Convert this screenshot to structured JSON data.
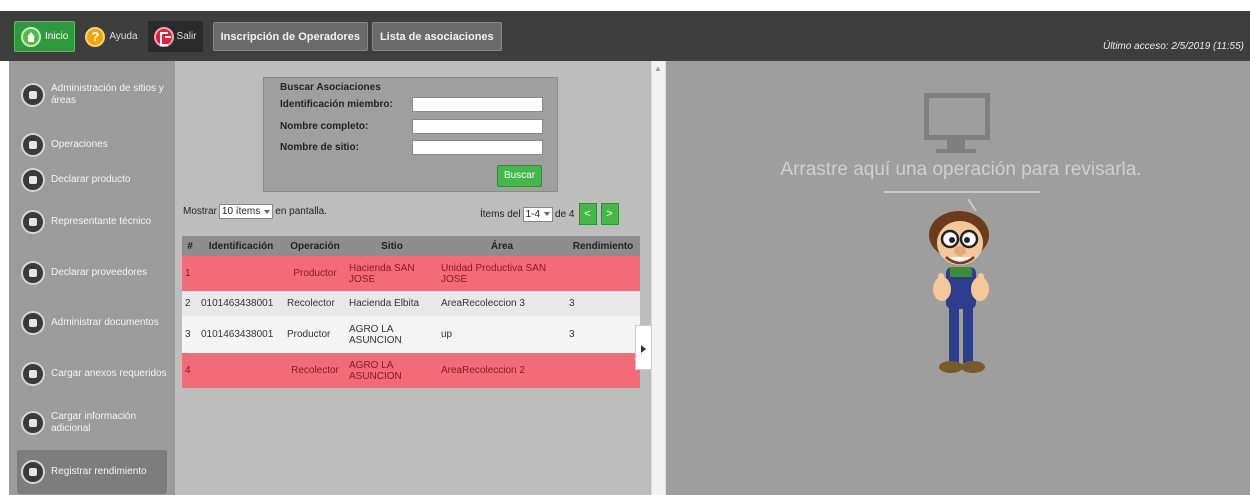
{
  "topbar": {
    "home_label": "Inicio",
    "help_label": "Ayuda",
    "exit_label": "Salir",
    "tab_register": "Inscripción de Operadores",
    "tab_associations": "Lista de asociaciones",
    "last_access": "Último acceso: 2/5/2019 (11:55)"
  },
  "sidebar": {
    "items": [
      {
        "label": "Administración de sitios y áreas",
        "icon": "sites-icon"
      },
      {
        "label": "Operaciones",
        "icon": "operations-icon"
      },
      {
        "label": "Declarar producto",
        "icon": "product-icon"
      },
      {
        "label": "Representante técnico",
        "icon": "technician-icon"
      },
      {
        "label": "Declarar proveedores",
        "icon": "suppliers-icon"
      },
      {
        "label": "Administrar documentos",
        "icon": "documents-icon"
      },
      {
        "label": "Cargar anexos requeridos",
        "icon": "attachments-icon"
      },
      {
        "label": "Cargar información adicional",
        "icon": "upload-info-icon"
      },
      {
        "label": "Registrar rendimiento",
        "icon": "chart-icon"
      }
    ]
  },
  "search": {
    "title": "Buscar Asociaciones",
    "id_label": "Identificación miembro:",
    "id_value": "",
    "name_label": "Nombre completo:",
    "name_value": "",
    "site_label": "Nombre de sitio:",
    "site_value": "",
    "button": "Buscar"
  },
  "listing": {
    "show_prefix": "Mostrar",
    "show_value": "10 ítems",
    "show_suffix": "en pantalla.",
    "pager_prefix": "Ítems del",
    "pager_value": "1-4",
    "pager_suffix": "de 4",
    "prev": "<",
    "next": ">"
  },
  "table": {
    "headers": [
      "#",
      "Identificación",
      "Operación",
      "Sitio",
      "Área",
      "Rendimiento"
    ],
    "rows": [
      {
        "num": "1",
        "id": "",
        "op": "Productor",
        "site": "Hacienda SAN JOSE",
        "area": "Unidad Productiva SAN JOSE",
        "perf": "",
        "status": "red"
      },
      {
        "num": "2",
        "id": "0101463438001",
        "op": "Recolector",
        "site": "Hacienda Elbita",
        "area": "AreaRecoleccion 3",
        "perf": "3",
        "status": "odd"
      },
      {
        "num": "3",
        "id": "0101463438001",
        "op": "Productor",
        "site": "AGRO LA ASUNCION",
        "area": "up",
        "perf": "3",
        "status": "even"
      },
      {
        "num": "4",
        "id": "",
        "op": "Recolector",
        "site": "AGRO LA ASUNCION",
        "area": "AreaRecoleccion 2",
        "perf": "",
        "status": "red"
      }
    ]
  },
  "dropzone": {
    "text": "Arrastre aquí una operación para revisarla."
  },
  "colors": {
    "accent_green": "#45b649",
    "warning_row": "#f26b78",
    "topbar": "#3e3e3e"
  }
}
